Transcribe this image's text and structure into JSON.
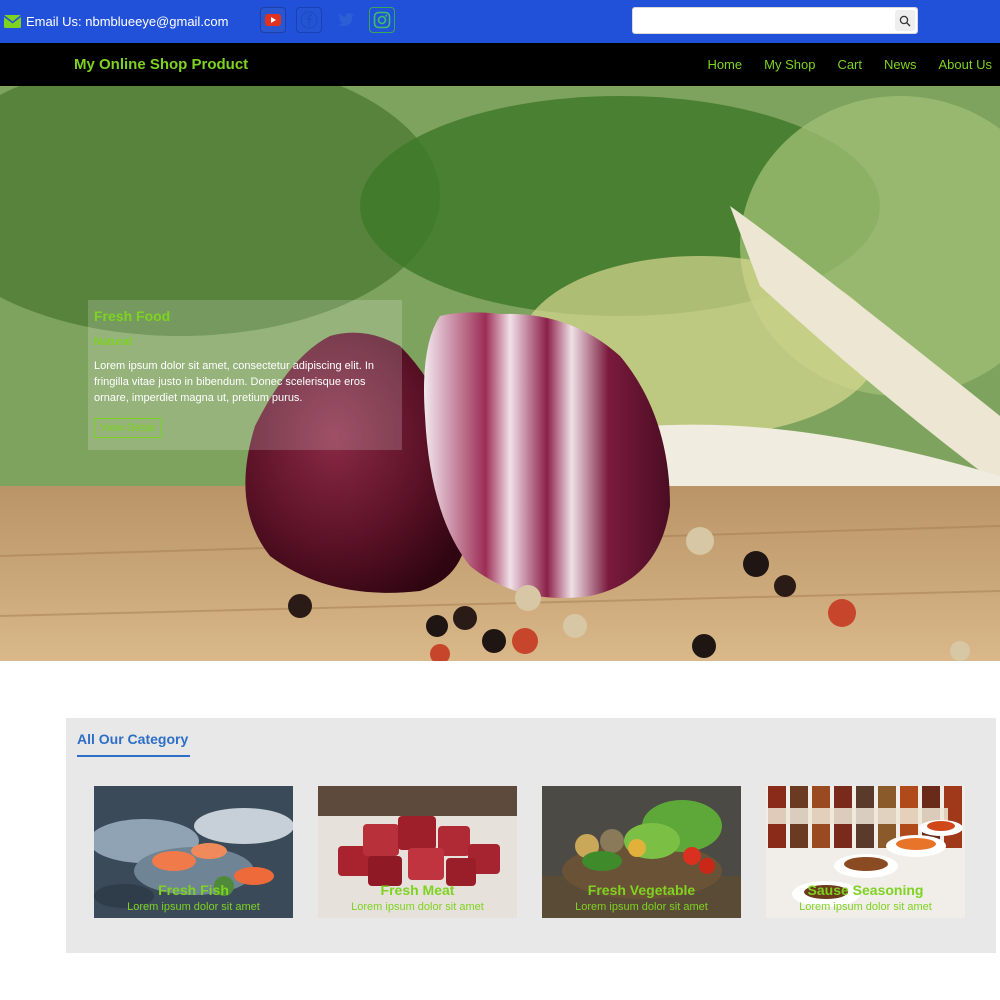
{
  "topbar": {
    "email_label": "Email Us: nbmblueeye@gmail.com",
    "social": [
      "youtube-icon",
      "facebook-icon",
      "twitter-icon",
      "instagram-icon"
    ],
    "search_placeholder": ""
  },
  "navbar": {
    "brand": "My Online Shop Product",
    "links": [
      "Home",
      "My Shop",
      "Cart",
      "News",
      "About Us"
    ]
  },
  "hero": {
    "title": "Fresh Food",
    "subtitle": "Natural",
    "text": "Lorem ipsum dolor sit amet, consectetur adipiscing elit. In fringilla vitae justo in bibendum. Donec scelerisque eros ornare, imperdiet magna ut, pretium purus.",
    "button": "View Detail"
  },
  "category": {
    "title": "All Our Category",
    "cards": [
      {
        "title": "Fresh Fish",
        "text": "Lorem ipsum dolor sit amet"
      },
      {
        "title": "Fresh Meat",
        "text": "Lorem ipsum dolor sit amet"
      },
      {
        "title": "Fresh Vegetable",
        "text": "Lorem ipsum dolor sit amet"
      },
      {
        "title": "Sause Seasoning",
        "text": "Lorem ipsum dolor sit amet"
      }
    ]
  },
  "colors": {
    "topbar": "#2251d9",
    "navbar": "#000000",
    "accent_green": "#7ed321",
    "category_blue": "#2d6ec7",
    "category_bg": "#e8e8e8"
  }
}
